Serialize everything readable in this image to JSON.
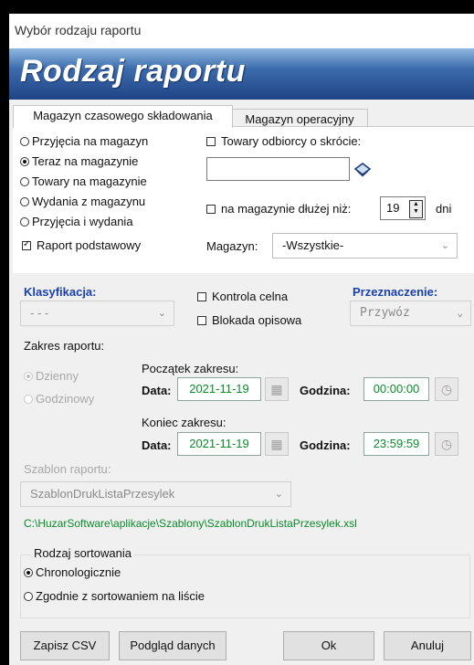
{
  "window": {
    "title": "Wybór rodzaju raportu",
    "banner": "Rodzaj raportu"
  },
  "tabs": [
    {
      "label": "Magazyn czasowego składowania",
      "active": true
    },
    {
      "label": "Magazyn operacyjny",
      "active": false
    }
  ],
  "report_types": [
    {
      "label": "Przyjęcia na magazyn",
      "selected": false
    },
    {
      "label": "Teraz na magazynie",
      "selected": true
    },
    {
      "label": "Towary na magazynie",
      "selected": false
    },
    {
      "label": "Wydania z magazynu",
      "selected": false
    },
    {
      "label": "Przyjęcia i wydania",
      "selected": false
    }
  ],
  "basic_report": {
    "label": "Raport podstawowy",
    "checked": true
  },
  "recipient_goods": {
    "label": "Towary odbiorcy o skrócie:",
    "checked": false,
    "value": ""
  },
  "longer_than": {
    "label": "na magazynie dłużej niż:",
    "checked": false,
    "value": "19",
    "unit": "dni"
  },
  "warehouse": {
    "label": "Magazyn:",
    "value": "-Wszystkie-"
  },
  "classification": {
    "label": "Klasyfikacja:",
    "value": "- - -"
  },
  "customs_control": {
    "label": "Kontrola celna",
    "checked": false
  },
  "descriptive_block": {
    "label": "Blokada opisowa",
    "checked": false
  },
  "destination": {
    "label": "Przeznaczenie:",
    "value": "Przywóz"
  },
  "range": {
    "label": "Zakres raportu:",
    "modes": [
      {
        "label": "Dzienny",
        "selected": true
      },
      {
        "label": "Godzinowy",
        "selected": false
      }
    ],
    "start": {
      "label": "Początek zakresu:",
      "date_label": "Data:",
      "date": "2021-11-19",
      "time_label": "Godzina:",
      "time": "00:00:00"
    },
    "end": {
      "label": "Koniec zakresu:",
      "date_label": "Data:",
      "date": "2021-11-19",
      "time_label": "Godzina:",
      "time": "23:59:59"
    }
  },
  "template": {
    "label": "Szablon raportu:",
    "value": "SzablonDrukListaPrzesylek",
    "path": "C:\\HuzarSoftware\\aplikacje\\Szablony\\SzablonDrukListaPrzesylek.xsl"
  },
  "sorting": {
    "label": "Rodzaj sortowania",
    "options": [
      {
        "label": "Chronologicznie",
        "selected": true
      },
      {
        "label": "Zgodnie z sortowaniem na liście",
        "selected": false
      }
    ]
  },
  "buttons": {
    "save_csv": "Zapisz CSV",
    "preview": "Podgląd danych",
    "ok": "Ok",
    "cancel": "Anuluj"
  },
  "icons": {
    "book": "book-icon",
    "calendar": "calendar-icon",
    "clock": "clock-icon",
    "chevron": "chevron-down-icon"
  }
}
